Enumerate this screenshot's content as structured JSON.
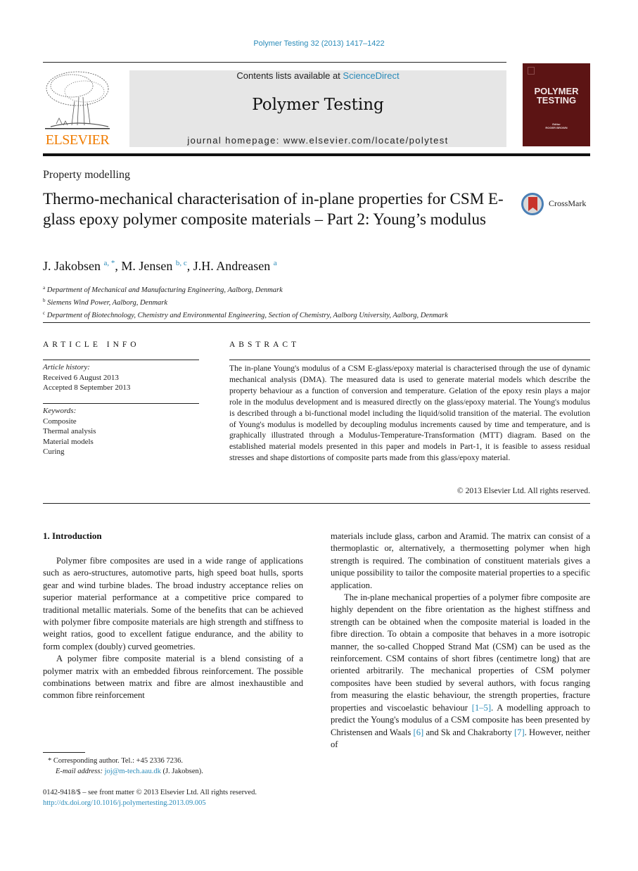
{
  "header": {
    "journal_ref": "Polymer Testing 32 (2013) 1417–1422",
    "contents_prefix": "Contents lists available at ",
    "contents_link": "ScienceDirect",
    "journal_title": "Polymer Testing",
    "homepage": "journal homepage: www.elsevier.com/locate/polytest",
    "publisher_logo_text": "ELSEVIER",
    "cover": {
      "title_line1": "POLYMER",
      "title_line2": "TESTING",
      "editor_label": "Editor",
      "editor_name": "ROGER BROWN",
      "color": "#5c1414"
    },
    "accent_color": "#2a8bb9",
    "publisher_color": "#f07c00"
  },
  "article": {
    "section": "Property modelling",
    "title": "Thermo-mechanical characterisation of in-plane properties for CSM E-glass epoxy polymer composite materials – Part 2: Young’s modulus",
    "crossmark_label": "CrossMark",
    "authors": [
      {
        "name": "J. Jakobsen",
        "sup": "a, *"
      },
      {
        "name": "M. Jensen",
        "sup": "b, c"
      },
      {
        "name": "J.H. Andreasen",
        "sup": "a"
      }
    ],
    "affiliations": [
      {
        "key": "a",
        "text": "Department of Mechanical and Manufacturing Engineering, Aalborg, Denmark"
      },
      {
        "key": "b",
        "text": "Siemens Wind Power, Aalborg, Denmark"
      },
      {
        "key": "c",
        "text": "Department of Biotechnology, Chemistry and Environmental Engineering, Section of Chemistry, Aalborg University, Aalborg, Denmark"
      }
    ]
  },
  "article_info": {
    "heading": "ARTICLE INFO",
    "history_label": "Article history:",
    "received": "Received 6 August 2013",
    "accepted": "Accepted 8 September 2013",
    "keywords_label": "Keywords:",
    "keywords": [
      "Composite",
      "Thermal analysis",
      "Material models",
      "Curing"
    ]
  },
  "abstract": {
    "heading": "ABSTRACT",
    "text": "The in-plane Young's modulus of a CSM E-glass/epoxy material is characterised through the use of dynamic mechanical analysis (DMA). The measured data is used to generate material models which describe the property behaviour as a function of conversion and temperature. Gelation of the epoxy resin plays a major role in the modulus development and is measured directly on the glass/epoxy material. The Young's modulus is described through a bi-functional model including the liquid/solid transition of the material. The evolution of Young's modulus is modelled by decoupling modulus increments caused by time and temperature, and is graphically illustrated through a Modulus-Temperature-Transformation (MTT) diagram. Based on the established material models presented in this paper and models in Part-1, it is feasible to assess residual stresses and shape distortions of composite parts made from this glass/epoxy material.",
    "copyright": "© 2013 Elsevier Ltd. All rights reserved."
  },
  "body": {
    "intro_heading": "1.  Introduction",
    "left_paragraphs": [
      "Polymer fibre composites are used in a wide range of applications such as aero-structures, automotive parts, high speed boat hulls, sports gear and wind turbine blades. The broad industry acceptance relies on superior material performance at a competitive price compared to traditional metallic materials. Some of the benefits that can be achieved with polymer fibre composite materials are high strength and stiffness to weight ratios, good to excellent fatigue endurance, and the ability to form complex (doubly) curved geometries.",
      "A polymer fibre composite material is a blend consisting of a polymer matrix with an embedded fibrous reinforcement. The possible combinations between matrix and fibre are almost inexhaustible and common fibre reinforcement"
    ],
    "right_cont": "materials include glass, carbon and Aramid. The matrix can consist of a thermoplastic or, alternatively, a thermosetting polymer when high strength is required. The combination of constituent materials gives a unique possibility to tailor the composite material properties to a specific application.",
    "right_p2_a": "The in-plane mechanical properties of a polymer fibre composite are highly dependent on the fibre orientation as the highest stiffness and strength can be obtained when the composite material is loaded in the fibre direction. To obtain a composite that behaves in a more isotropic manner, the so-called Chopped Strand Mat (CSM) can be used as the reinforcement. CSM contains of short fibres (centimetre long) that are oriented arbitrarily. The mechanical properties of CSM polymer composites have been studied by several authors, with focus ranging from measuring the elastic behaviour, the strength properties, fracture properties and viscoelastic behaviour ",
    "ref_1_5": "[1–5]",
    "right_p2_b": ". A modelling approach to predict the Young's modulus of a CSM composite has been presented by Christensen and Waals ",
    "ref_6": "[6]",
    "right_p2_c": " and Sk and Chakraborty ",
    "ref_7": "[7]",
    "right_p2_d": ". However, neither of"
  },
  "footnotes": {
    "corresponding": "*  Corresponding author. Tel.: +45 2336 7236.",
    "email_label": "E-mail address:",
    "email": "joj@m-tech.aau.dk",
    "email_suffix": " (J. Jakobsen).",
    "front_matter": "0142-9418/$ – see front matter © 2013 Elsevier Ltd. All rights reserved.",
    "doi": "http://dx.doi.org/10.1016/j.polymertesting.2013.09.005"
  }
}
